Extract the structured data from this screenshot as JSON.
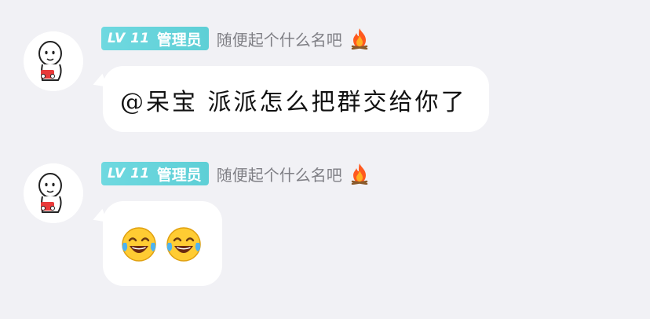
{
  "messages": [
    {
      "level_badge": "LV 11",
      "role": "管理员",
      "nickname": "随便起个什么名吧",
      "nickname_icon": "fire-icon",
      "text": "@呆宝 派派怎么把群交给你了"
    },
    {
      "level_badge": "LV 11",
      "role": "管理员",
      "nickname": "随便起个什么名吧",
      "nickname_icon": "fire-icon",
      "emojis": [
        "tears-of-joy-emoji",
        "tears-of-joy-emoji"
      ]
    }
  ],
  "colors": {
    "background": "#F1F1F5",
    "badge": "#5ECFD6",
    "nickname": "#7F7F85",
    "bubble": "#FFFFFF"
  }
}
